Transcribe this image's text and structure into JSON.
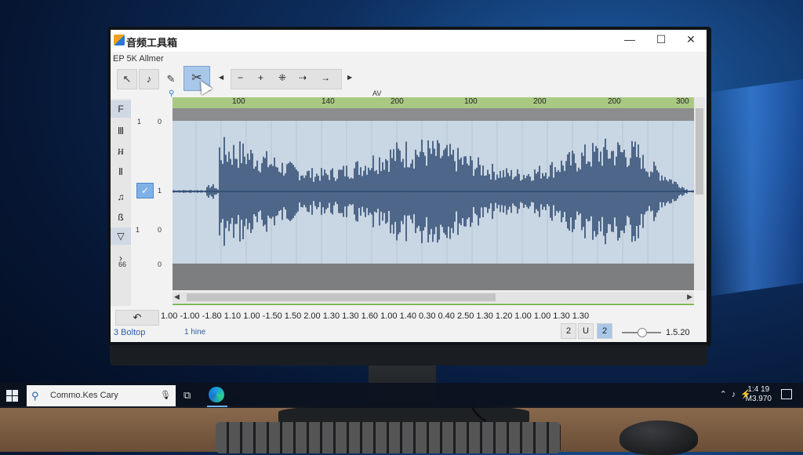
{
  "app": {
    "title": "音频工具箱",
    "menu": "EP 5K Allmer",
    "window_controls": {
      "minimize": "—",
      "maximize": "☐",
      "close": "✕"
    }
  },
  "toolbar": {
    "tools": [
      "↖",
      "♪",
      "✎"
    ],
    "cut_icon": "✂",
    "group": [
      "−",
      "+",
      "⁜",
      "⇢",
      "→"
    ],
    "left_arrow": "◀",
    "right_arrow": "▶",
    "marker_label": "AV"
  },
  "sidebar": {
    "items": [
      "F",
      "Ⅲ",
      "អ",
      "Ⅱ",
      "♫",
      "ß",
      "▽",
      "›"
    ],
    "left_markers": [
      "1",
      "1",
      "1",
      "1",
      "66"
    ],
    "right_markers": [
      "0",
      "0",
      "1",
      "0",
      "0"
    ]
  },
  "timeline": {
    "ticks": [
      "100",
      "140",
      "200",
      "100",
      "200",
      "200",
      "300"
    ]
  },
  "bottom": {
    "undo_icon": "↶",
    "timecodes": "1.00 -1.00 -1.80  1.10  1.00 -1.50  1.50  2.00  1.30  1.30  1.60  1.00  1.40  0.30  0.40  2.50  1.30  1.20  1.00  1.00  1.30  1.30",
    "status_left": "3 Boltop",
    "status_mid": "1 hine",
    "buttons": [
      "2",
      "U",
      "2"
    ],
    "zoom": "1.5.20"
  },
  "taskbar": {
    "search_text": "Commo.Kes Cary",
    "clock_time": "1:4 19",
    "clock_date": "M3.970"
  },
  "colors": {
    "waveform": "#2f4b72",
    "ruler": "#a9c983",
    "accent": "#2a79d6"
  }
}
